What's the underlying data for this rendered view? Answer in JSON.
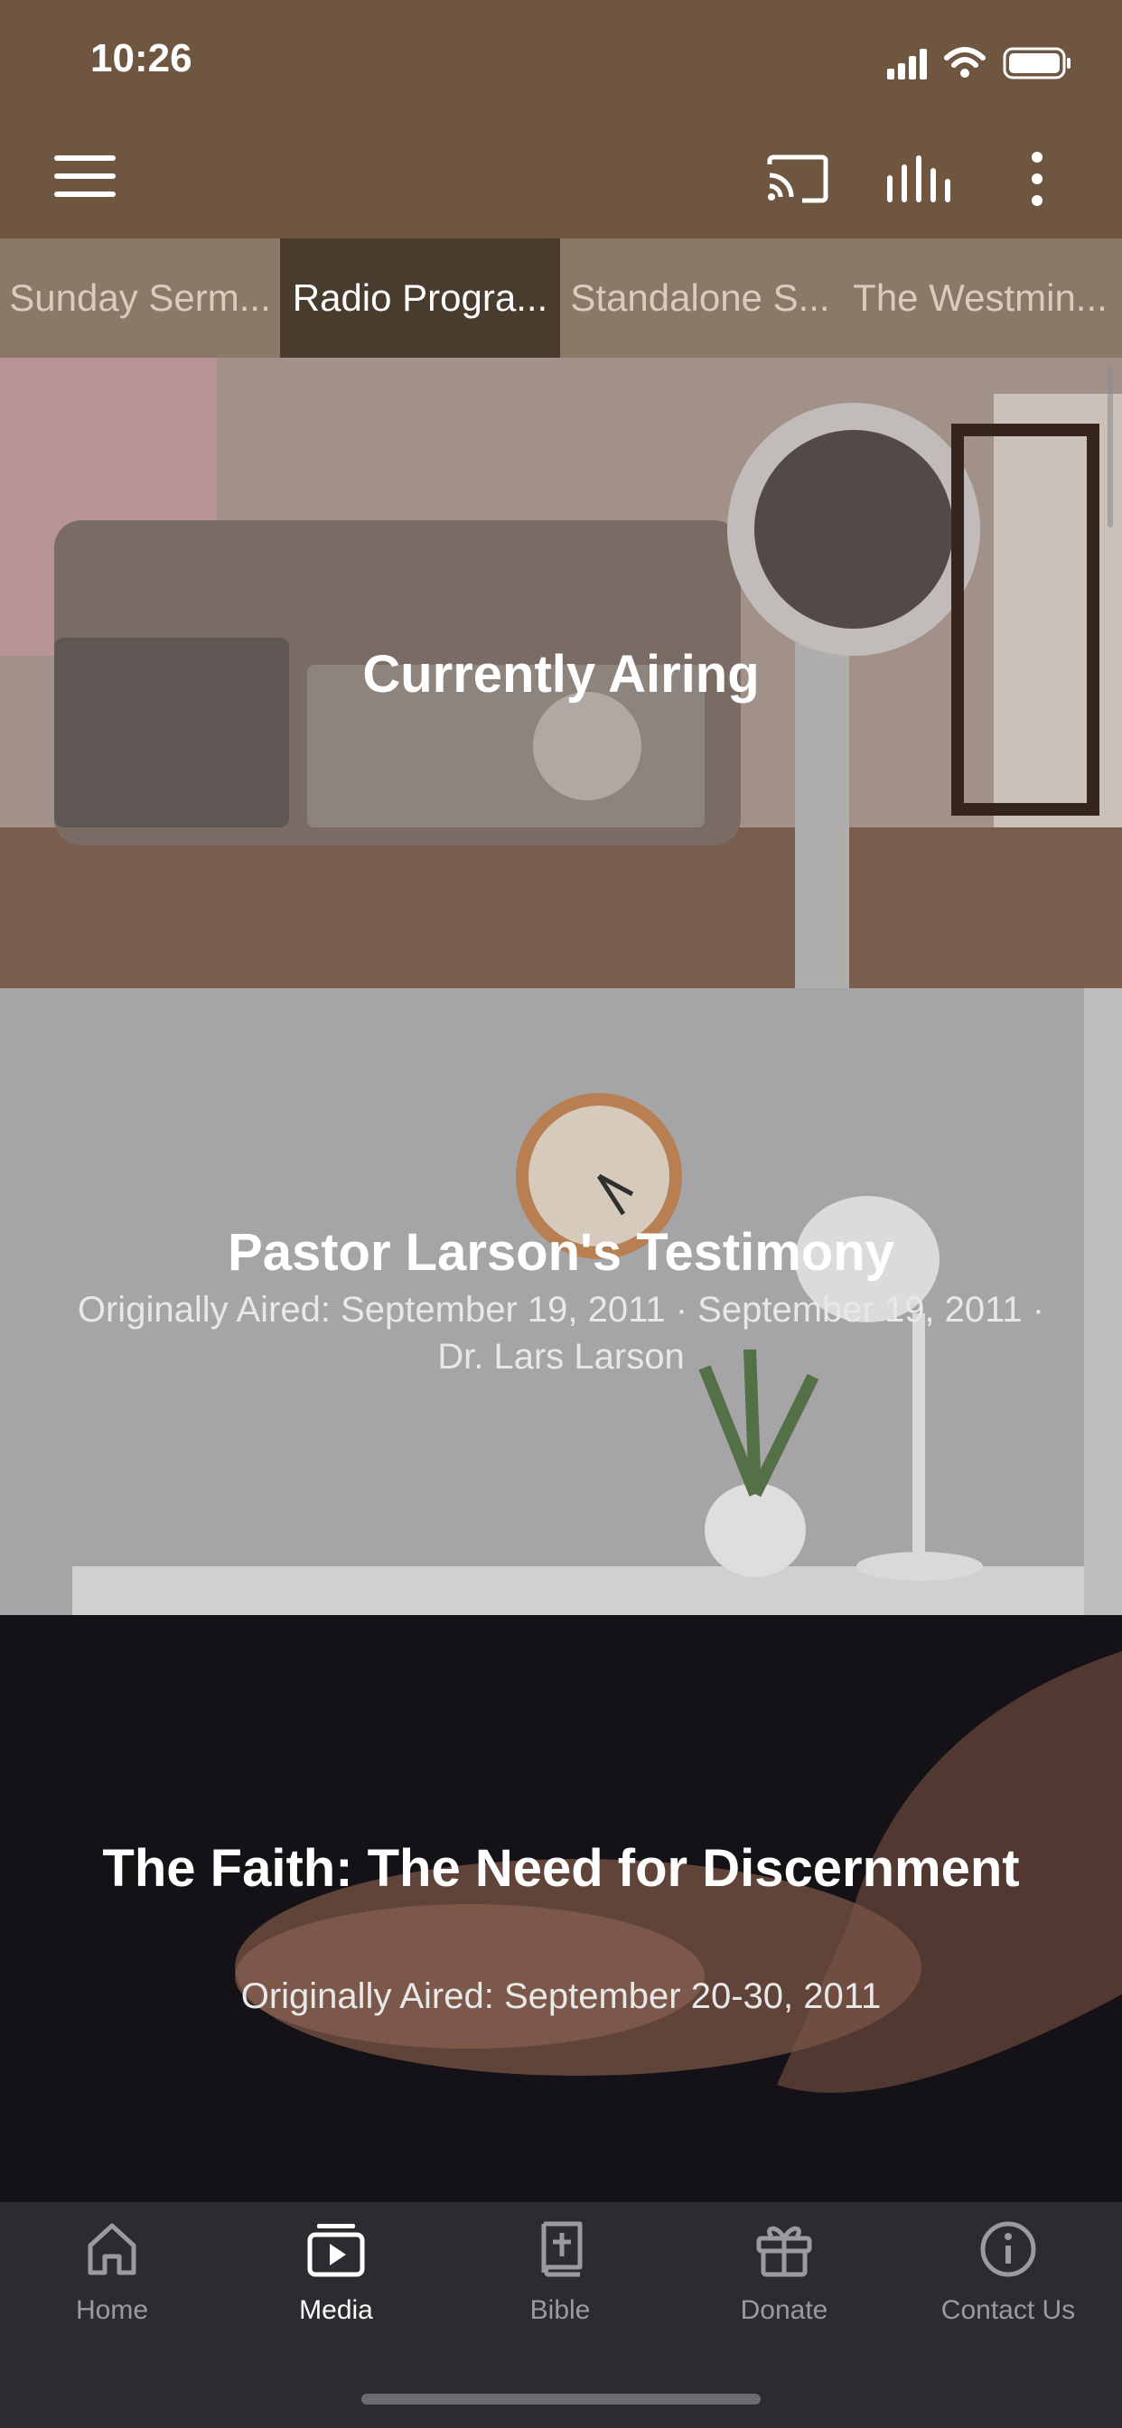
{
  "status_bar": {
    "time": "10:26"
  },
  "colors": {
    "header": "#6e5640",
    "tab_bar": "#8b7866",
    "tab_active": "#4a3b2f",
    "bottom_nav": "#2b2c2f"
  },
  "toolbar": {
    "menu_icon": "hamburger-menu-icon",
    "cast_icon": "cast-icon",
    "equalizer_icon": "equalizer-icon",
    "more_icon": "more-vertical-icon"
  },
  "tabs": [
    {
      "label": "Sunday Serm...",
      "active": false
    },
    {
      "label": "Radio Progra...",
      "active": true
    },
    {
      "label": "Standalone S...",
      "active": false
    },
    {
      "label": "The Westmin...",
      "active": false
    }
  ],
  "cards": [
    {
      "title": "Currently Airing",
      "subtitle": ""
    },
    {
      "title": "Pastor Larson's Testimony",
      "subtitle": "Originally Aired: September 19, 2011 · September 19, 2011 · Dr. Lars Larson"
    },
    {
      "title": "The Faith: The Need for Discernment",
      "subtitle": "Originally Aired: September 20-30, 2011"
    }
  ],
  "bottom_nav": [
    {
      "label": "Home",
      "icon": "home-icon",
      "active": false
    },
    {
      "label": "Media",
      "icon": "media-play-icon",
      "active": true
    },
    {
      "label": "Bible",
      "icon": "bible-icon",
      "active": false
    },
    {
      "label": "Donate",
      "icon": "gift-icon",
      "active": false
    },
    {
      "label": "Contact Us",
      "icon": "info-icon",
      "active": false
    }
  ]
}
